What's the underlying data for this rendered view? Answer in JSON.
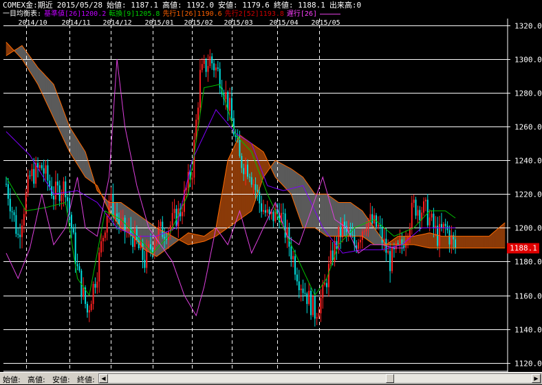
{
  "header": {
    "instrument": "COMEX金:期近",
    "date": "2015/05/28",
    "open": "始値: 1187.1",
    "high": "高値: 1192.0",
    "low": "安値: 1179.6",
    "close": "終値: 1188.1",
    "volume": "出来高:0"
  },
  "legend": {
    "title": "一目均衡表:",
    "items": [
      {
        "label": "基準値[26]1200.2",
        "color": "#c000ff"
      },
      {
        "label": "転換[9]1205.8",
        "color": "#00d000"
      },
      {
        "label": "先行1[26]1190.6",
        "color": "#ff6000"
      },
      {
        "label": "先行2[52]1193.8",
        "color": "#d00000"
      },
      {
        "label": "遅行[26]",
        "color": "#ff40ff"
      }
    ]
  },
  "bottom": {
    "open_label": "始値:",
    "high_label": "高値:",
    "low_label": "安値:",
    "close_label": "終値:"
  },
  "last_price_tag": "1188.1",
  "colors": {
    "up": "#ff2020",
    "down": "#00e0e0",
    "kijun": "#8000ff",
    "tenkan": "#00c000",
    "chikou": "#e040e0",
    "cloud_bear": "#5a5a5a",
    "cloud_bull": "#8a3a08",
    "span_edge": "#ff6a00",
    "price_tag": "#e00000"
  },
  "chart_data": {
    "type": "candlestick",
    "x_ticks": [
      "2014/10",
      "2014/11",
      "2014/12",
      "2015/01",
      "2015/02",
      "2015/03",
      "2015/04",
      "2015/05"
    ],
    "y_ticks": [
      "1320.0",
      "1300.0",
      "1280.0",
      "1260.0",
      "1240.0",
      "1220.0",
      "1200.0",
      "1180.0",
      "1160.0",
      "1140.0",
      "1120.0"
    ],
    "ylim": [
      1115,
      1324
    ],
    "last_close": 1188.1,
    "close_anchors": [
      [
        0,
        1226
      ],
      [
        6,
        1195
      ],
      [
        12,
        1230
      ],
      [
        18,
        1236
      ],
      [
        24,
        1220
      ],
      [
        30,
        1225
      ],
      [
        36,
        1175
      ],
      [
        41,
        1150
      ],
      [
        46,
        1175
      ],
      [
        52,
        1217
      ],
      [
        58,
        1200
      ],
      [
        64,
        1195
      ],
      [
        70,
        1180
      ],
      [
        76,
        1197
      ],
      [
        82,
        1200
      ],
      [
        88,
        1210
      ],
      [
        94,
        1235
      ],
      [
        98,
        1290
      ],
      [
        103,
        1300
      ],
      [
        108,
        1290
      ],
      [
        113,
        1270
      ],
      [
        118,
        1240
      ],
      [
        123,
        1235
      ],
      [
        128,
        1215
      ],
      [
        133,
        1205
      ],
      [
        138,
        1210
      ],
      [
        143,
        1190
      ],
      [
        148,
        1170
      ],
      [
        152,
        1160
      ],
      [
        156,
        1150
      ],
      [
        160,
        1160
      ],
      [
        165,
        1185
      ],
      [
        170,
        1200
      ],
      [
        176,
        1190
      ],
      [
        182,
        1205
      ],
      [
        188,
        1200
      ],
      [
        194,
        1180
      ],
      [
        200,
        1190
      ],
      [
        206,
        1213
      ],
      [
        212,
        1210
      ],
      [
        218,
        1195
      ],
      [
        222,
        1200
      ],
      [
        227,
        1188
      ]
    ],
    "kijun": [
      [
        0,
        1257
      ],
      [
        12,
        1243
      ],
      [
        24,
        1220
      ],
      [
        36,
        1222
      ],
      [
        46,
        1215
      ],
      [
        56,
        1200
      ],
      [
        66,
        1195
      ],
      [
        76,
        1195
      ],
      [
        86,
        1200
      ],
      [
        94,
        1240
      ],
      [
        106,
        1270
      ],
      [
        116,
        1256
      ],
      [
        124,
        1250
      ],
      [
        132,
        1225
      ],
      [
        140,
        1222
      ],
      [
        150,
        1225
      ],
      [
        160,
        1200
      ],
      [
        170,
        1185
      ],
      [
        180,
        1187
      ],
      [
        190,
        1187
      ],
      [
        200,
        1190
      ],
      [
        210,
        1200
      ],
      [
        220,
        1200
      ],
      [
        227,
        1200
      ]
    ],
    "tenkan": [
      [
        0,
        1230
      ],
      [
        10,
        1210
      ],
      [
        20,
        1212
      ],
      [
        30,
        1215
      ],
      [
        36,
        1170
      ],
      [
        42,
        1160
      ],
      [
        50,
        1210
      ],
      [
        58,
        1205
      ],
      [
        66,
        1195
      ],
      [
        74,
        1185
      ],
      [
        82,
        1195
      ],
      [
        92,
        1220
      ],
      [
        100,
        1283
      ],
      [
        108,
        1285
      ],
      [
        116,
        1255
      ],
      [
        124,
        1245
      ],
      [
        132,
        1220
      ],
      [
        140,
        1200
      ],
      [
        148,
        1180
      ],
      [
        156,
        1160
      ],
      [
        162,
        1170
      ],
      [
        168,
        1190
      ],
      [
        176,
        1200
      ],
      [
        186,
        1205
      ],
      [
        196,
        1195
      ],
      [
        206,
        1200
      ],
      [
        214,
        1210
      ],
      [
        222,
        1210
      ],
      [
        227,
        1205.8
      ]
    ],
    "chikou": [
      [
        0,
        1185
      ],
      [
        6,
        1170
      ],
      [
        12,
        1188
      ],
      [
        18,
        1220
      ],
      [
        24,
        1190
      ],
      [
        30,
        1200
      ],
      [
        36,
        1230
      ],
      [
        40,
        1200
      ],
      [
        46,
        1195
      ],
      [
        52,
        1230
      ],
      [
        56,
        1300
      ],
      [
        60,
        1260
      ],
      [
        66,
        1225
      ],
      [
        72,
        1200
      ],
      [
        78,
        1190
      ],
      [
        84,
        1180
      ],
      [
        90,
        1160
      ],
      [
        96,
        1148
      ],
      [
        100,
        1165
      ],
      [
        106,
        1200
      ],
      [
        112,
        1190
      ],
      [
        118,
        1210
      ],
      [
        124,
        1185
      ],
      [
        130,
        1200
      ],
      [
        136,
        1215
      ],
      [
        142,
        1195
      ],
      [
        148,
        1190
      ],
      [
        154,
        1210
      ],
      [
        160,
        1230
      ],
      [
        166,
        1205
      ],
      [
        172,
        1200
      ],
      [
        178,
        1185
      ],
      [
        184,
        1190
      ],
      [
        190,
        1190
      ],
      [
        196,
        1188
      ],
      [
        201,
        1188
      ]
    ],
    "senkou1": [
      [
        0,
        1310
      ],
      [
        8,
        1300
      ],
      [
        16,
        1285
      ],
      [
        24,
        1265
      ],
      [
        32,
        1245
      ],
      [
        40,
        1230
      ],
      [
        46,
        1225
      ],
      [
        52,
        1210
      ],
      [
        58,
        1200
      ],
      [
        64,
        1195
      ],
      [
        70,
        1187
      ],
      [
        76,
        1183
      ],
      [
        84,
        1190
      ],
      [
        92,
        1197
      ],
      [
        100,
        1195
      ],
      [
        106,
        1200
      ],
      [
        112,
        1240
      ],
      [
        118,
        1255
      ],
      [
        124,
        1250
      ],
      [
        130,
        1245
      ],
      [
        136,
        1230
      ],
      [
        144,
        1220
      ],
      [
        150,
        1200
      ],
      [
        156,
        1200
      ],
      [
        162,
        1195
      ],
      [
        168,
        1195
      ],
      [
        174,
        1195
      ],
      [
        180,
        1195
      ],
      [
        186,
        1190
      ],
      [
        192,
        1190
      ],
      [
        198,
        1195
      ],
      [
        206,
        1195
      ],
      [
        214,
        1197
      ],
      [
        220,
        1195
      ],
      [
        227,
        1195
      ],
      [
        236,
        1195
      ],
      [
        244,
        1195
      ],
      [
        252,
        1203
      ]
    ],
    "senkou2": [
      [
        0,
        1302
      ],
      [
        8,
        1308
      ],
      [
        16,
        1295
      ],
      [
        24,
        1285
      ],
      [
        32,
        1260
      ],
      [
        40,
        1245
      ],
      [
        46,
        1222
      ],
      [
        52,
        1215
      ],
      [
        58,
        1215
      ],
      [
        64,
        1210
      ],
      [
        70,
        1205
      ],
      [
        76,
        1200
      ],
      [
        84,
        1195
      ],
      [
        92,
        1190
      ],
      [
        100,
        1192
      ],
      [
        106,
        1195
      ],
      [
        112,
        1200
      ],
      [
        118,
        1205
      ],
      [
        124,
        1210
      ],
      [
        130,
        1230
      ],
      [
        136,
        1240
      ],
      [
        144,
        1235
      ],
      [
        150,
        1230
      ],
      [
        156,
        1220
      ],
      [
        162,
        1220
      ],
      [
        168,
        1215
      ],
      [
        174,
        1215
      ],
      [
        180,
        1210
      ],
      [
        186,
        1200
      ],
      [
        192,
        1190
      ],
      [
        198,
        1190
      ],
      [
        206,
        1190
      ],
      [
        214,
        1188
      ],
      [
        220,
        1188
      ],
      [
        227,
        1188
      ],
      [
        236,
        1188
      ],
      [
        244,
        1188
      ],
      [
        252,
        1188
      ]
    ]
  }
}
